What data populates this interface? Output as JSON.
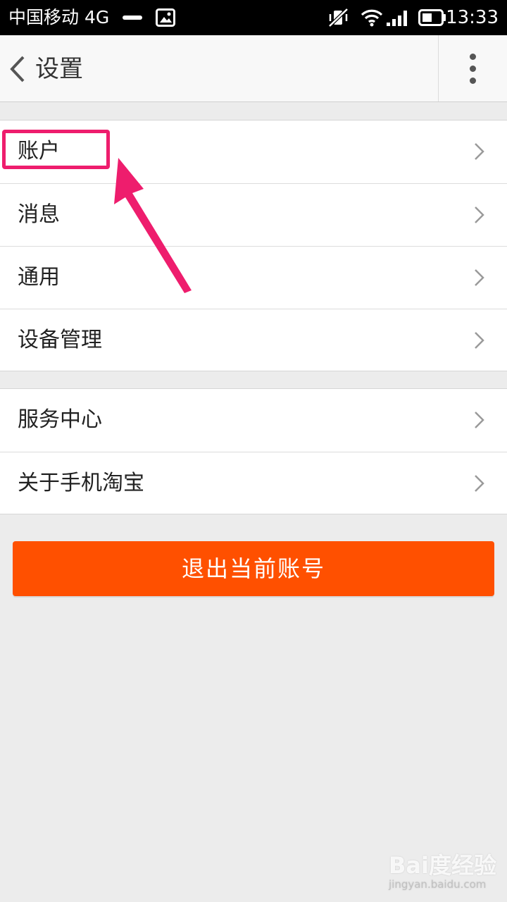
{
  "status_bar": {
    "carrier": "中国移动 4G",
    "time": "13:33"
  },
  "header": {
    "title": "设置"
  },
  "sections": [
    {
      "items": [
        {
          "label": "账户"
        },
        {
          "label": "消息"
        },
        {
          "label": "通用"
        },
        {
          "label": "设备管理"
        }
      ]
    },
    {
      "items": [
        {
          "label": "服务中心"
        },
        {
          "label": "关于手机淘宝"
        }
      ]
    }
  ],
  "logout": {
    "label": "退出当前账号"
  },
  "colors": {
    "accent": "#ff5000",
    "annotation": "#ee1d6d",
    "background": "#ececec"
  },
  "watermark": {
    "logo": "Bai度经验",
    "sub": "jingyan.baidu.com"
  }
}
